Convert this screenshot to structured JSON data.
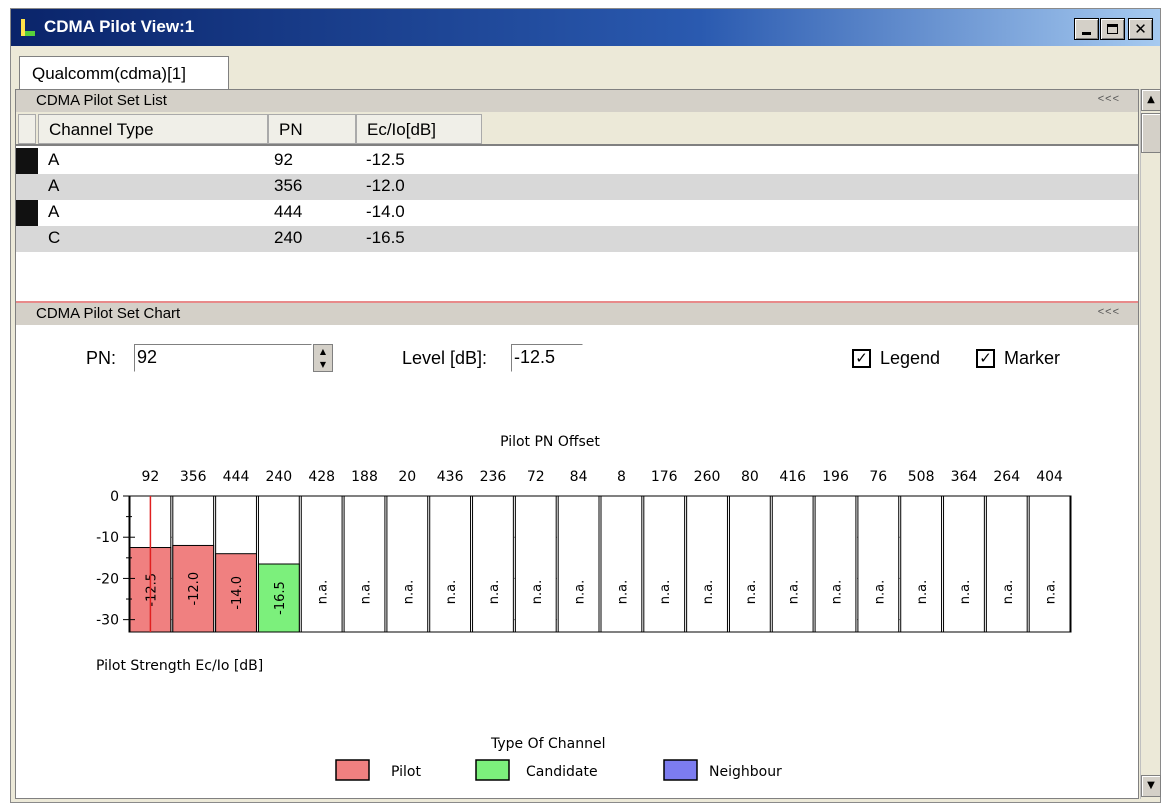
{
  "window": {
    "title": "CDMA Pilot View:1"
  },
  "tabs": [
    {
      "label": "Qualcomm(cdma)[1]"
    }
  ],
  "pilot_list": {
    "title": "CDMA Pilot Set List",
    "collapse": "<<<",
    "columns": [
      "Channel Type",
      "PN",
      "Ec/Io[dB]"
    ],
    "rows": [
      {
        "channel_type": "A",
        "pn": "92",
        "ecio": "-12.5"
      },
      {
        "channel_type": "A",
        "pn": "356",
        "ecio": "-12.0"
      },
      {
        "channel_type": "A",
        "pn": "444",
        "ecio": "-14.0"
      },
      {
        "channel_type": "C",
        "pn": "240",
        "ecio": "-16.5"
      }
    ]
  },
  "pilot_chart": {
    "title": "CDMA Pilot Set Chart",
    "collapse": "<<<",
    "pn_label": "PN:",
    "pn_value": "92",
    "level_label": "Level [dB]:",
    "level_value": "-12.5",
    "legend_checkbox": {
      "label": "Legend",
      "checked": true
    },
    "marker_checkbox": {
      "label": "Marker",
      "checked": true
    }
  },
  "colors": {
    "pilot": "#f08080",
    "candidate": "#7cf07c",
    "neighbour": "#7c7cf0",
    "marker": "#e02020"
  },
  "chart_data": {
    "type": "bar",
    "title": "Pilot PN Offset",
    "ylabel": "Pilot Strength Ec/Io [dB]",
    "ylim": [
      -33,
      0
    ],
    "yticks": [
      "0",
      "-10",
      "-20",
      "-30"
    ],
    "ytick_values": [
      0,
      -10,
      -20,
      -30
    ],
    "categories": [
      "92",
      "356",
      "444",
      "240",
      "428",
      "188",
      "20",
      "436",
      "236",
      "72",
      "84",
      "8",
      "176",
      "260",
      "80",
      "416",
      "196",
      "76",
      "508",
      "364",
      "264",
      "404"
    ],
    "values": [
      -12.5,
      -12.0,
      -14.0,
      -16.5,
      null,
      null,
      null,
      null,
      null,
      null,
      null,
      null,
      null,
      null,
      null,
      null,
      null,
      null,
      null,
      null,
      null,
      null
    ],
    "labels": [
      "-12.5",
      "-12.0",
      "-14.0",
      "-16.5",
      "n.a.",
      "n.a.",
      "n.a.",
      "n.a.",
      "n.a.",
      "n.a.",
      "n.a.",
      "n.a.",
      "n.a.",
      "n.a.",
      "n.a.",
      "n.a.",
      "n.a.",
      "n.a.",
      "n.a.",
      "n.a.",
      "n.a.",
      "n.a."
    ],
    "channel_types": [
      "pilot",
      "pilot",
      "pilot",
      "candidate",
      "none",
      "none",
      "none",
      "none",
      "none",
      "none",
      "none",
      "none",
      "none",
      "none",
      "none",
      "none",
      "none",
      "none",
      "none",
      "none",
      "none",
      "none"
    ],
    "marker_category": "92",
    "legend": {
      "title": "Type Of Channel",
      "entries": [
        {
          "name": "Pilot",
          "color": "#f08080"
        },
        {
          "name": "Candidate",
          "color": "#7cf07c"
        },
        {
          "name": "Neighbour",
          "color": "#7c7cf0"
        }
      ]
    }
  }
}
